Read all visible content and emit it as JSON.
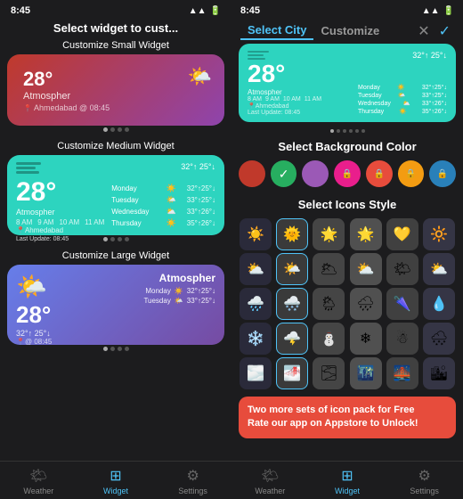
{
  "left": {
    "status_time": "8:45",
    "panel_title": "Select widget to cust...",
    "sections": [
      {
        "label": "Customize Small Widget"
      },
      {
        "label": "Customize Medium Widget"
      },
      {
        "label": "Customize Large Widget"
      }
    ],
    "small_widget": {
      "temp": "28°",
      "condition": "Atmospher",
      "location": "Ahmedabad @ 08:45"
    },
    "medium_widget": {
      "temp": "28°",
      "condition": "Atmospher",
      "range": "32°↑ 25°↓",
      "times": [
        "8 AM",
        "9 AM",
        "10 AM",
        "11 AM"
      ],
      "location": "Ahmedabad",
      "last_update": "Last Update: 08:45",
      "forecast": [
        {
          "day": "Monday",
          "range": "32°↑ 25°↓",
          "icon": "☀️"
        },
        {
          "day": "Tuesday",
          "range": "33°↑ 25°↓",
          "icon": "🌤️"
        },
        {
          "day": "Wednesday",
          "range": "33°↑ 26°↓",
          "icon": "⛅"
        },
        {
          "day": "Thursday",
          "range": "35°↑ 26°↓",
          "icon": "☀️"
        }
      ]
    },
    "large_widget": {
      "temp": "28°",
      "atmos": "Atmospher",
      "range": "32°↑ 25°↓",
      "location": "@ 08:45",
      "forecast": [
        {
          "day": "Monday",
          "range": "32°↑ 25°↓",
          "icon": "☀️"
        },
        {
          "day": "Tuesday",
          "range": "33°↑ 25°↓",
          "icon": "🌤️"
        }
      ]
    },
    "tabs": [
      {
        "label": "Weather",
        "icon": "🌤",
        "active": false
      },
      {
        "label": "Widget",
        "icon": "▦",
        "active": true
      },
      {
        "label": "Settings",
        "icon": "⚙",
        "active": false
      }
    ]
  },
  "right": {
    "status_time": "8:45",
    "tabs": [
      {
        "label": "Select City",
        "active": true
      },
      {
        "label": "Customize",
        "active": false
      }
    ],
    "preview_widget": {
      "temp": "28°",
      "condition": "Atmospher",
      "range": "32°↑ 25°↓",
      "times": [
        "8 AM",
        "9 AM",
        "10 AM",
        "11 AM"
      ],
      "location": "Ahmedabad",
      "last_update": "Last Update: 08:45",
      "forecast": [
        {
          "day": "Monday",
          "range": "32°↑ 25°↓",
          "icon": "☀️"
        },
        {
          "day": "Tuesday",
          "range": "33°↑ 25°↓",
          "icon": "🌤️"
        },
        {
          "day": "Wednesday",
          "range": "33°↑ 26°↓",
          "icon": "⛅"
        },
        {
          "day": "Thursday",
          "range": "35°↑ 26°↓",
          "icon": "☀️"
        }
      ]
    },
    "bg_color_label": "Select Background Color",
    "colors": [
      {
        "hex": "#c0392b",
        "selected": false,
        "locked": false
      },
      {
        "hex": "#27ae60",
        "selected": true,
        "locked": false
      },
      {
        "hex": "#9b59b6",
        "selected": false,
        "locked": false
      },
      {
        "hex": "#e91e8c",
        "selected": false,
        "locked": true
      },
      {
        "hex": "#e74c3c",
        "selected": false,
        "locked": true
      },
      {
        "hex": "#f39c12",
        "selected": false,
        "locked": true
      },
      {
        "hex": "#2980b9",
        "selected": false,
        "locked": true
      }
    ],
    "icon_style_label": "Select Icons Style",
    "icon_cols": [
      {
        "active": false,
        "icons": [
          "☀️",
          "⛅",
          "🌧️",
          "❄️",
          "🌫️"
        ]
      },
      {
        "active": false,
        "icons": [
          "🌞",
          "🌤️",
          "🌨️",
          "🌩️",
          "🌁"
        ]
      },
      {
        "active": false,
        "icons": [
          "☀",
          "🌥",
          "🌦",
          "⛄",
          "🌫"
        ]
      },
      {
        "active": false,
        "icons": [
          "🌟",
          "⛅",
          "🌧",
          "❄",
          "🌃"
        ]
      },
      {
        "active": false,
        "icons": [
          "💛",
          "🌤",
          "🌂",
          "☃",
          "🌉"
        ]
      },
      {
        "active": false,
        "icons": [
          "🔆",
          "⛅",
          "💧",
          "🌨",
          "🏙"
        ]
      }
    ],
    "promo_text": "Two more sets of icon pack for ",
    "promo_bold": "Free",
    "promo_sub": "Rate our app on Appstore to Unlock!",
    "tabs_bottom": [
      {
        "label": "Weather",
        "icon": "🌤",
        "active": false
      },
      {
        "label": "Widget",
        "icon": "▦",
        "active": true
      },
      {
        "label": "Settings",
        "icon": "⚙",
        "active": false
      }
    ]
  }
}
